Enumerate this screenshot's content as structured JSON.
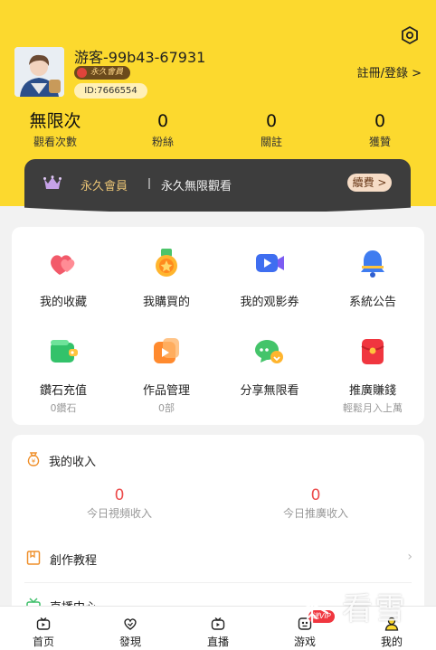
{
  "profile": {
    "username": "游客-99b43-67931",
    "vip_badge": "永久會員",
    "id_label": "ID:7666554",
    "login_link": "註冊/登錄 >"
  },
  "stats": [
    {
      "value": "無限次",
      "label": "觀看次數"
    },
    {
      "value": "0",
      "label": "粉絲"
    },
    {
      "value": "0",
      "label": "關註"
    },
    {
      "value": "0",
      "label": "獲贊"
    }
  ],
  "vip": {
    "title": "永久會員",
    "desc": "永久無限觀看",
    "renew": "續費 >"
  },
  "grid": [
    {
      "label": "我的收藏",
      "icon": "hearts-icon",
      "sub": ""
    },
    {
      "label": "我購買的",
      "icon": "medal-icon",
      "sub": ""
    },
    {
      "label": "我的观影券",
      "icon": "video-ticket-icon",
      "sub": ""
    },
    {
      "label": "系統公告",
      "icon": "bell-icon",
      "sub": ""
    },
    {
      "label": "鑽石充值",
      "icon": "wallet-icon",
      "sub": "0鑽石"
    },
    {
      "label": "作品管理",
      "icon": "video-folder-icon",
      "sub": "0部"
    },
    {
      "label": "分享無限看",
      "icon": "chat-share-icon",
      "sub": ""
    },
    {
      "label": "推廣賺錢",
      "icon": "red-envelope-icon",
      "sub": "輕鬆月入上萬"
    }
  ],
  "income": {
    "title": "我的收入",
    "video_value": "0",
    "video_label": "今日視頻收入",
    "promo_value": "0",
    "promo_label": "今日推廣收入"
  },
  "rows": [
    {
      "title": "創作教程",
      "icon": "book-icon"
    },
    {
      "title": "直播中心",
      "icon": "tv-icon"
    }
  ],
  "tabs": [
    {
      "label": "首页",
      "icon": "home-tv-icon"
    },
    {
      "label": "發現",
      "icon": "discover-icon"
    },
    {
      "label": "直播",
      "icon": "live-icon"
    },
    {
      "label": "游戏",
      "icon": "game-icon"
    },
    {
      "label": "我的",
      "icon": "me-icon"
    }
  ],
  "tab_badge": "送VIP",
  "watermark": "看雪",
  "colors": {
    "header_bg": "#fcd92e",
    "vip_bar_bg": "#3d3d3d",
    "accent_red": "#ec4a4a"
  }
}
